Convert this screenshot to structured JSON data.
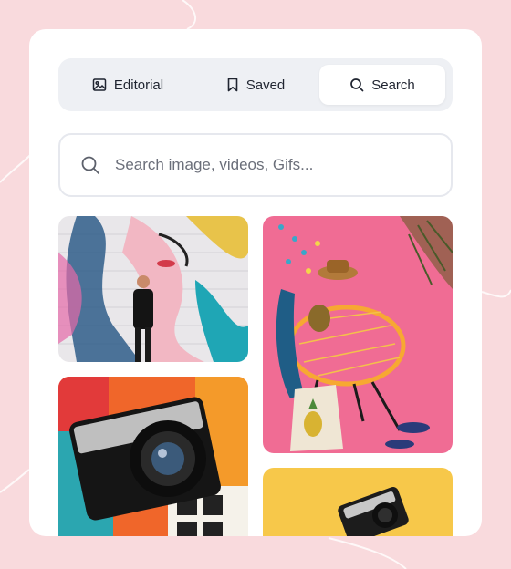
{
  "tabs": {
    "editorial": {
      "label": "Editorial",
      "icon": "image-icon"
    },
    "saved": {
      "label": "Saved",
      "icon": "bookmark-icon"
    },
    "search": {
      "label": "Search",
      "icon": "search-icon",
      "active": true
    }
  },
  "search": {
    "placeholder": "Search image, videos, Gifs...",
    "value": ""
  },
  "gallery": [
    {
      "id": "mural",
      "subject": "colorful-mural-walker"
    },
    {
      "id": "chair",
      "subject": "pink-room-chair-pineapple-bag"
    },
    {
      "id": "camera",
      "subject": "nikon-camera-film-slides"
    },
    {
      "id": "camera-yellow",
      "subject": "camera-on-yellow"
    }
  ],
  "colors": {
    "page_background": "#f9dadd",
    "card_background": "#ffffff",
    "tabbar_background": "#eef0f4",
    "text": "#1f2430"
  }
}
